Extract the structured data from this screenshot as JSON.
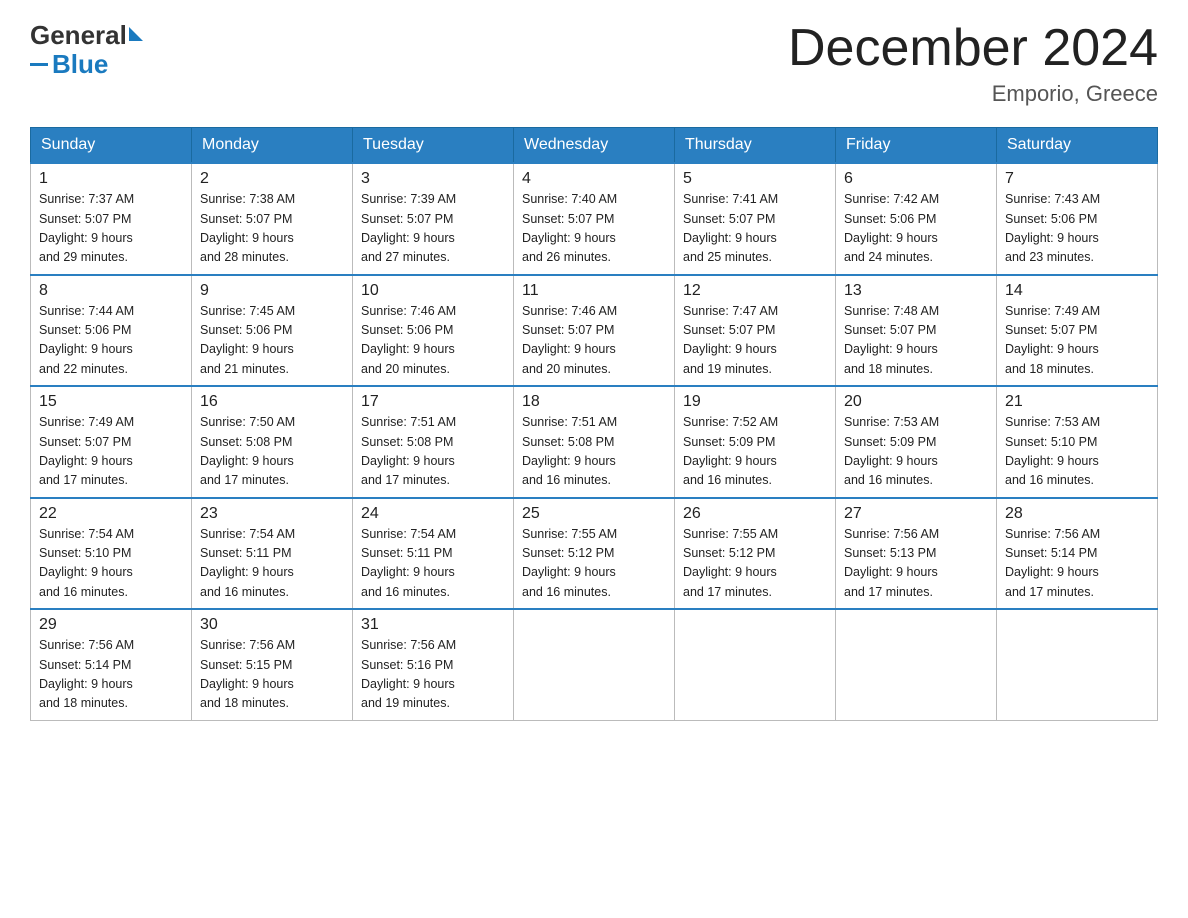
{
  "logo": {
    "general": "General",
    "blue": "Blue"
  },
  "header": {
    "title": "December 2024",
    "subtitle": "Emporio, Greece"
  },
  "days_of_week": [
    "Sunday",
    "Monday",
    "Tuesday",
    "Wednesday",
    "Thursday",
    "Friday",
    "Saturday"
  ],
  "weeks": [
    [
      {
        "day": "1",
        "sunrise": "7:37 AM",
        "sunset": "5:07 PM",
        "daylight": "9 hours and 29 minutes."
      },
      {
        "day": "2",
        "sunrise": "7:38 AM",
        "sunset": "5:07 PM",
        "daylight": "9 hours and 28 minutes."
      },
      {
        "day": "3",
        "sunrise": "7:39 AM",
        "sunset": "5:07 PM",
        "daylight": "9 hours and 27 minutes."
      },
      {
        "day": "4",
        "sunrise": "7:40 AM",
        "sunset": "5:07 PM",
        "daylight": "9 hours and 26 minutes."
      },
      {
        "day": "5",
        "sunrise": "7:41 AM",
        "sunset": "5:07 PM",
        "daylight": "9 hours and 25 minutes."
      },
      {
        "day": "6",
        "sunrise": "7:42 AM",
        "sunset": "5:06 PM",
        "daylight": "9 hours and 24 minutes."
      },
      {
        "day": "7",
        "sunrise": "7:43 AM",
        "sunset": "5:06 PM",
        "daylight": "9 hours and 23 minutes."
      }
    ],
    [
      {
        "day": "8",
        "sunrise": "7:44 AM",
        "sunset": "5:06 PM",
        "daylight": "9 hours and 22 minutes."
      },
      {
        "day": "9",
        "sunrise": "7:45 AM",
        "sunset": "5:06 PM",
        "daylight": "9 hours and 21 minutes."
      },
      {
        "day": "10",
        "sunrise": "7:46 AM",
        "sunset": "5:06 PM",
        "daylight": "9 hours and 20 minutes."
      },
      {
        "day": "11",
        "sunrise": "7:46 AM",
        "sunset": "5:07 PM",
        "daylight": "9 hours and 20 minutes."
      },
      {
        "day": "12",
        "sunrise": "7:47 AM",
        "sunset": "5:07 PM",
        "daylight": "9 hours and 19 minutes."
      },
      {
        "day": "13",
        "sunrise": "7:48 AM",
        "sunset": "5:07 PM",
        "daylight": "9 hours and 18 minutes."
      },
      {
        "day": "14",
        "sunrise": "7:49 AM",
        "sunset": "5:07 PM",
        "daylight": "9 hours and 18 minutes."
      }
    ],
    [
      {
        "day": "15",
        "sunrise": "7:49 AM",
        "sunset": "5:07 PM",
        "daylight": "9 hours and 17 minutes."
      },
      {
        "day": "16",
        "sunrise": "7:50 AM",
        "sunset": "5:08 PM",
        "daylight": "9 hours and 17 minutes."
      },
      {
        "day": "17",
        "sunrise": "7:51 AM",
        "sunset": "5:08 PM",
        "daylight": "9 hours and 17 minutes."
      },
      {
        "day": "18",
        "sunrise": "7:51 AM",
        "sunset": "5:08 PM",
        "daylight": "9 hours and 16 minutes."
      },
      {
        "day": "19",
        "sunrise": "7:52 AM",
        "sunset": "5:09 PM",
        "daylight": "9 hours and 16 minutes."
      },
      {
        "day": "20",
        "sunrise": "7:53 AM",
        "sunset": "5:09 PM",
        "daylight": "9 hours and 16 minutes."
      },
      {
        "day": "21",
        "sunrise": "7:53 AM",
        "sunset": "5:10 PM",
        "daylight": "9 hours and 16 minutes."
      }
    ],
    [
      {
        "day": "22",
        "sunrise": "7:54 AM",
        "sunset": "5:10 PM",
        "daylight": "9 hours and 16 minutes."
      },
      {
        "day": "23",
        "sunrise": "7:54 AM",
        "sunset": "5:11 PM",
        "daylight": "9 hours and 16 minutes."
      },
      {
        "day": "24",
        "sunrise": "7:54 AM",
        "sunset": "5:11 PM",
        "daylight": "9 hours and 16 minutes."
      },
      {
        "day": "25",
        "sunrise": "7:55 AM",
        "sunset": "5:12 PM",
        "daylight": "9 hours and 16 minutes."
      },
      {
        "day": "26",
        "sunrise": "7:55 AM",
        "sunset": "5:12 PM",
        "daylight": "9 hours and 17 minutes."
      },
      {
        "day": "27",
        "sunrise": "7:56 AM",
        "sunset": "5:13 PM",
        "daylight": "9 hours and 17 minutes."
      },
      {
        "day": "28",
        "sunrise": "7:56 AM",
        "sunset": "5:14 PM",
        "daylight": "9 hours and 17 minutes."
      }
    ],
    [
      {
        "day": "29",
        "sunrise": "7:56 AM",
        "sunset": "5:14 PM",
        "daylight": "9 hours and 18 minutes."
      },
      {
        "day": "30",
        "sunrise": "7:56 AM",
        "sunset": "5:15 PM",
        "daylight": "9 hours and 18 minutes."
      },
      {
        "day": "31",
        "sunrise": "7:56 AM",
        "sunset": "5:16 PM",
        "daylight": "9 hours and 19 minutes."
      },
      null,
      null,
      null,
      null
    ]
  ],
  "labels": {
    "sunrise": "Sunrise:",
    "sunset": "Sunset:",
    "daylight": "Daylight:"
  }
}
